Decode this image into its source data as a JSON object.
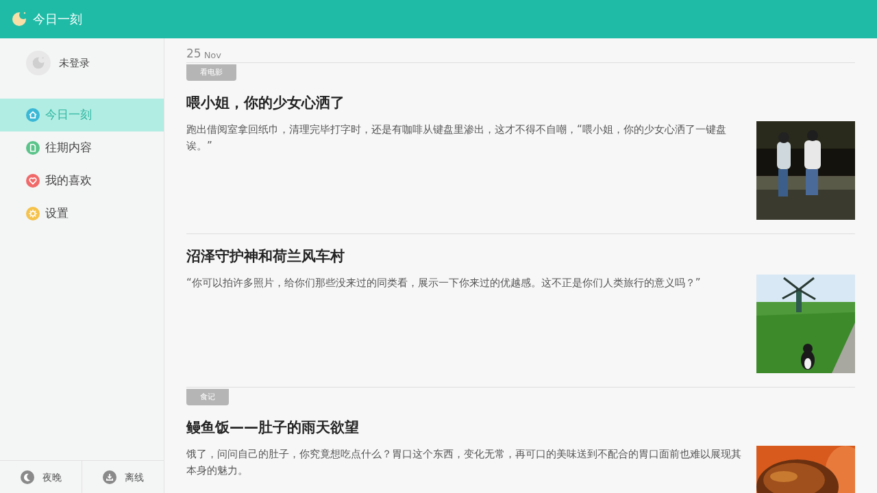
{
  "app_bar": {
    "title": "今日一刻"
  },
  "sidebar": {
    "user": {
      "name": "未登录"
    },
    "items": [
      {
        "label": "今日一刻",
        "kind": "home",
        "selected": true
      },
      {
        "label": "往期内容",
        "kind": "archive",
        "selected": false
      },
      {
        "label": "我的喜欢",
        "kind": "favorite",
        "selected": false
      },
      {
        "label": "设置",
        "kind": "settings",
        "selected": false
      }
    ],
    "footer": [
      {
        "label": "夜晚",
        "kind": "night"
      },
      {
        "label": "离线",
        "kind": "offline"
      }
    ]
  },
  "date": {
    "day": "25",
    "month": "Nov"
  },
  "articles": [
    {
      "tag": "看电影",
      "title": "喂小姐，你的少女心洒了",
      "excerpt": "跑出借阅室拿回纸巾，清理完毕打字时，还是有咖啡从键盘里渗出，这才不得不自嘲，“喂小姐，你的少女心洒了一键盘诶。”"
    },
    {
      "title": "沼泽守护神和荷兰风车村",
      "excerpt": "“你可以拍许多照片，给你们那些没来过的同类看，展示一下你来过的优越感。这不正是你们人类旅行的意义吗？”"
    },
    {
      "tag": "食记",
      "title": "鳗鱼饭——肚子的雨天欲望",
      "excerpt": "饿了，问问自己的肚子，你究竟想吃点什么？胃口这个东西，变化无常，再可口的美味送到不配合的胃口面前也难以展现其本身的魅力。"
    }
  ]
}
